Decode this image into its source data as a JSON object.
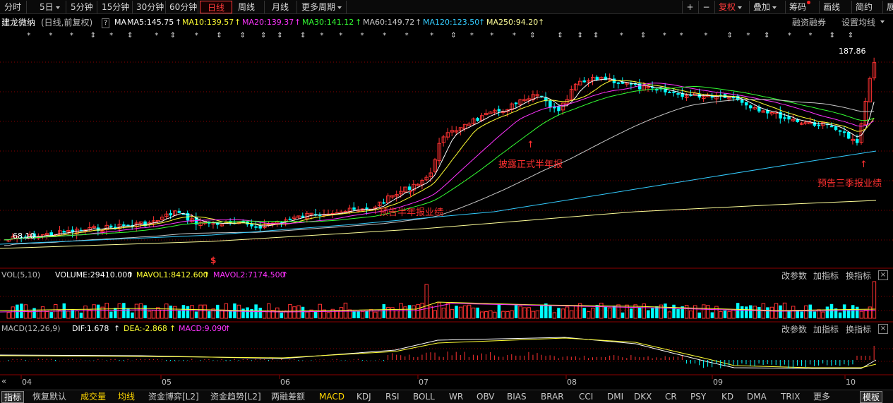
{
  "toolbar": {
    "periods": [
      {
        "label": "分时",
        "dropdown": false
      },
      {
        "label": "5日",
        "dropdown": true
      },
      {
        "label": "5分钟",
        "dropdown": false
      },
      {
        "label": "15分钟",
        "dropdown": false
      },
      {
        "label": "30分钟",
        "dropdown": false
      },
      {
        "label": "60分钟",
        "dropdown": false
      },
      {
        "label": "日线",
        "dropdown": false,
        "active": true
      },
      {
        "label": "周线",
        "dropdown": false
      },
      {
        "label": "月线",
        "dropdown": false
      },
      {
        "label": "更多周期",
        "dropdown": true
      }
    ],
    "right": {
      "plus": "+",
      "minus": "−",
      "fuquan": "复权",
      "diejia": "叠加",
      "chouma": "筹码",
      "huaxian": "画线",
      "jianyue": "简约",
      "zhan": "展"
    }
  },
  "stock": {
    "name": "建龙微纳",
    "mode": "(日线,前复权)",
    "help": "?",
    "ma_label": "MA",
    "ma": [
      {
        "label": "MA5:145.75",
        "color": "#ffffff"
      },
      {
        "label": "MA10:139.57",
        "color": "#ffff33"
      },
      {
        "label": "MA20:139.37",
        "color": "#ff33ff"
      },
      {
        "label": "MA30:141.12",
        "color": "#33ff33"
      },
      {
        "label": "MA60:149.72",
        "color": "#c8c8c8"
      },
      {
        "label": "MA120:123.50",
        "color": "#33ccff"
      },
      {
        "label": "MA250:94.20",
        "color": "#ffff99"
      }
    ],
    "right_links": {
      "margin": "融资融券",
      "settings": "设置均线"
    }
  },
  "price_labels": {
    "high": "187.86",
    "low": "68.10"
  },
  "annotations": {
    "a1": "预告半年报业绩",
    "a2": "披露正式半年报",
    "a3": "预告三季报业绩",
    "dollar": "$"
  },
  "vol_panel": {
    "title": "VOL(5,10)",
    "volume": "VOLUME:29410.000",
    "mavol1": "MAVOL1:8412.600",
    "mavol2": "MAVOL2:7174.500",
    "actions": {
      "params": "改参数",
      "add": "加指标",
      "switch": "换指标",
      "close": "×"
    }
  },
  "macd_panel": {
    "title": "MACD(12,26,9)",
    "dif": "DIF:1.678",
    "dea": "DEA:-2.868",
    "macd": "MACD:9.090",
    "actions": {
      "params": "改参数",
      "add": "加指标",
      "switch": "换指标",
      "close": "×"
    }
  },
  "x_axis": [
    "04",
    "05",
    "06",
    "07",
    "08",
    "09",
    "10"
  ],
  "nav": {
    "prev": "«"
  },
  "bottom_tabs": [
    "指标",
    "恢复默认",
    "成交量",
    "均线",
    "资金博弈[L2]",
    "资金趋势[L2]",
    "两融差额",
    "MACD",
    "KDJ",
    "RSI",
    "BOLL",
    "WR",
    "OBV",
    "BIAS",
    "BRAR",
    "CCI",
    "DMI",
    "DKX",
    "CR",
    "PSY",
    "KD",
    "DMA",
    "TRIX",
    "更多",
    "模板"
  ],
  "colors": {
    "up": "#ff3232",
    "down": "#00ffff",
    "background": "#000000",
    "annotation": "#ff3030"
  }
}
